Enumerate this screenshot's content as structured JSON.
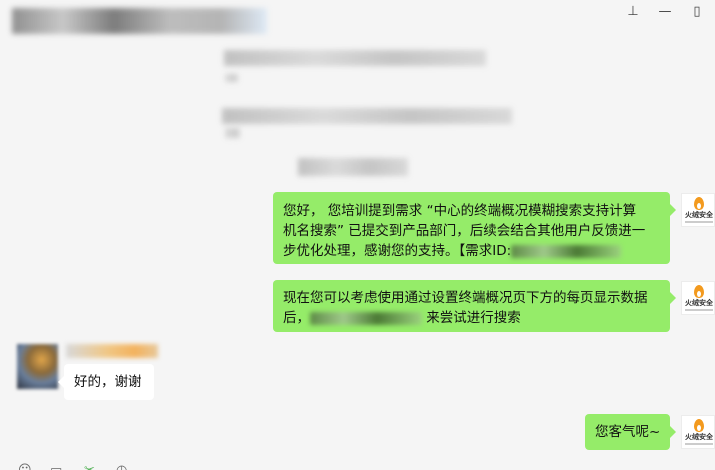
{
  "window": {
    "title": "██████ ████ ███",
    "pin_glyph": "⊥",
    "minimize_glyph": "—",
    "maximize_glyph": "▯"
  },
  "system_notices": [
    "███ ███ ████ ██████ ██ ███ ██",
    "████ ████ ██ ████████ ████ ████",
    "██████ ███"
  ],
  "messages": [
    {
      "side": "right",
      "line1": "您好， 您培训提到需求 “中心的终端概况模糊搜索支持计算",
      "line2_prefix": "机名搜索” 已提交到产品部门，后续会结合其他用户反馈进一",
      "line3_prefix": "步优化处理，感谢您的支持。【需求ID:",
      "redacted": "████████"
    },
    {
      "side": "right",
      "line1": "现在您可以考虑使用通过设置终端概况页下方的每页显示数据",
      "line2_prefix": "后，",
      "redacted": "███ ███ ██",
      "line2_suffix": " 来尝试进行搜索"
    },
    {
      "side": "left",
      "sender": "██████",
      "text": "好的，谢谢"
    },
    {
      "side": "right",
      "text": "您客气呢~"
    }
  ],
  "brand_avatar": {
    "name": "火绒安全",
    "icon": "flame-icon",
    "accent": "#f39a1e"
  },
  "colors": {
    "own_bubble": "#95ec69",
    "other_bubble": "#ffffff",
    "background": "#f5f5f5"
  },
  "toolbar": {
    "icons": [
      "emoji-icon",
      "folder-icon",
      "scissors-icon",
      "history-icon"
    ]
  }
}
